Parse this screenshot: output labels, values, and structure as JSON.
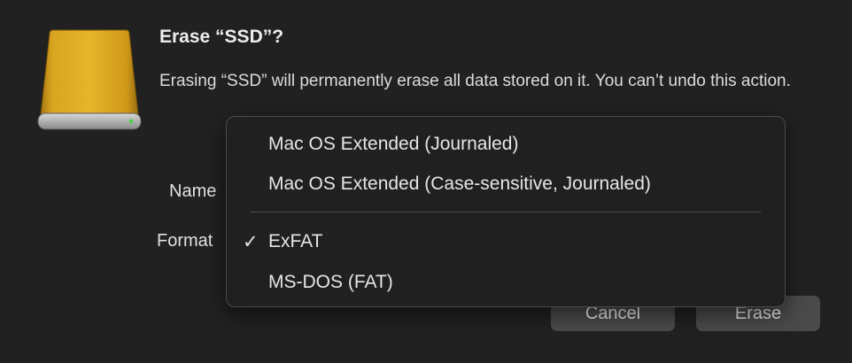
{
  "dialog": {
    "title": "Erase “SSD”?",
    "message": "Erasing “SSD” will permanently erase all data stored on it. You can’t undo this action.",
    "drive_icon": "external-drive-icon",
    "colors": {
      "background": "#212121",
      "drive_gold": "#d9a520",
      "button": "#4a4a4a"
    }
  },
  "form": {
    "name_label": "Name",
    "format_label": "Format"
  },
  "format_menu": {
    "items": [
      {
        "label": "Mac OS Extended (Journaled)",
        "selected": false
      },
      {
        "label": "Mac OS Extended (Case-sensitive, Journaled)",
        "selected": false
      },
      {
        "label": "ExFAT",
        "selected": true
      },
      {
        "label": "MS-DOS (FAT)",
        "selected": false
      }
    ],
    "check_glyph": "✓"
  },
  "buttons": {
    "cancel": "Cancel",
    "erase": "Erase"
  }
}
